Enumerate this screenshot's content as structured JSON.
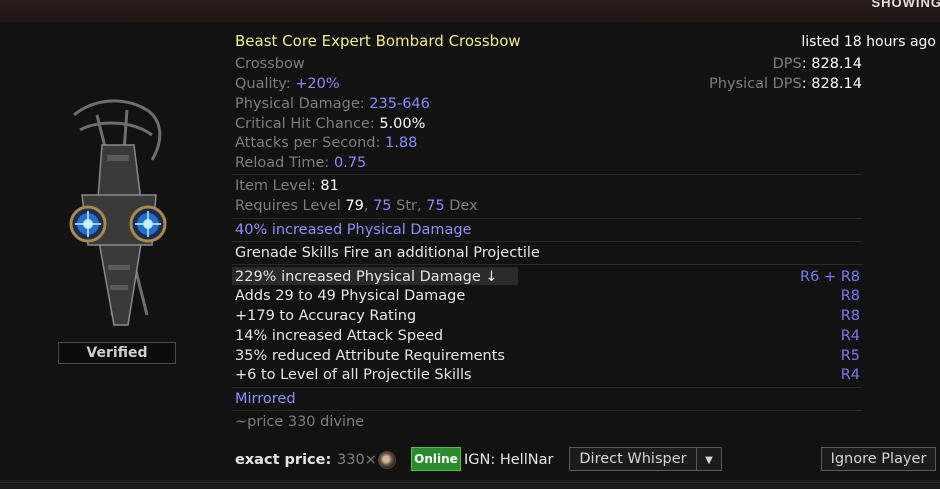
{
  "header": {
    "showing_text": "SHOWING"
  },
  "item": {
    "name": "Beast Core Expert Bombard Crossbow",
    "listed": "listed 18 hours ago",
    "base_type": "Crossbow",
    "quality_label": "Quality: ",
    "quality_value": "+20%",
    "phys_label": "Physical Damage: ",
    "phys_value": "235-646",
    "crit_label": "Critical Hit Chance: ",
    "crit_value": "5.00%",
    "aps_label": "Attacks per Second: ",
    "aps_value": "1.88",
    "reload_label": "Reload Time: ",
    "reload_value": "0.75",
    "dps_label": "DPS",
    "dps_value": ": 828.14",
    "pdps_label": "Physical DPS",
    "pdps_value": ": 828.14",
    "ilvl_label": "Item Level: ",
    "ilvl_value": "81",
    "req_prefix": "Requires Level ",
    "req_level": "79",
    "req_sep1": ", ",
    "req_str": "75",
    "req_str_label": " Str, ",
    "req_dex": "75",
    "req_dex_label": " Dex",
    "enchant": "40% increased Physical Damage",
    "implicit": "Grenade Skills Fire an additional Projectile",
    "explicits": [
      {
        "text": "229% increased Physical Damage ↓",
        "tier": "R6 + R8"
      },
      {
        "text": "Adds 29 to 49 Physical Damage",
        "tier": "R8"
      },
      {
        "text": "+179 to Accuracy Rating",
        "tier": "R8"
      },
      {
        "text": "14% increased Attack Speed",
        "tier": "R4"
      },
      {
        "text": "35% reduced Attribute Requirements",
        "tier": "R5"
      },
      {
        "text": "+6 to Level of all Projectile Skills",
        "tier": "R4"
      }
    ],
    "mirrored": "Mirrored",
    "price_note": "~price 330 divine",
    "verified": "Verified"
  },
  "listing": {
    "exact_price_label": "exact price:",
    "price_amount": "330×",
    "currency_icon": "divine-orb-icon",
    "status": "Online",
    "ign": "IGN: HellNar",
    "whisper_label": "Direct Whisper",
    "ignore_label": "Ignore Player"
  },
  "colors": {
    "title": "#f3ec7f",
    "value_blue": "#8888ff",
    "online": "#2b8a2b",
    "panel": "#121212"
  }
}
